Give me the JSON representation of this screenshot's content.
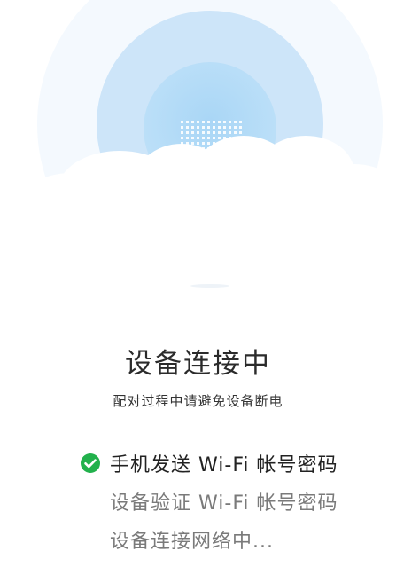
{
  "colors": {
    "accent_green": "#22b14c",
    "halo_outer": "#cfe6f9",
    "halo_inner": "#b3dbf7",
    "text_primary": "#222222",
    "text_pending": "#7a7a7a"
  },
  "illustration": {
    "icons": [
      "router-icon",
      "cloud-icon"
    ]
  },
  "status": {
    "title": "设备连接中",
    "subtitle": "配对过程中请避免设备断电"
  },
  "steps": [
    {
      "label": "手机发送 Wi-Fi 帐号密码",
      "state": "done",
      "icon": "check-circle-icon"
    },
    {
      "label": "设备验证 Wi-Fi 帐号密码",
      "state": "pending",
      "icon": ""
    },
    {
      "label": "设备连接网络中...",
      "state": "pending",
      "icon": ""
    }
  ]
}
